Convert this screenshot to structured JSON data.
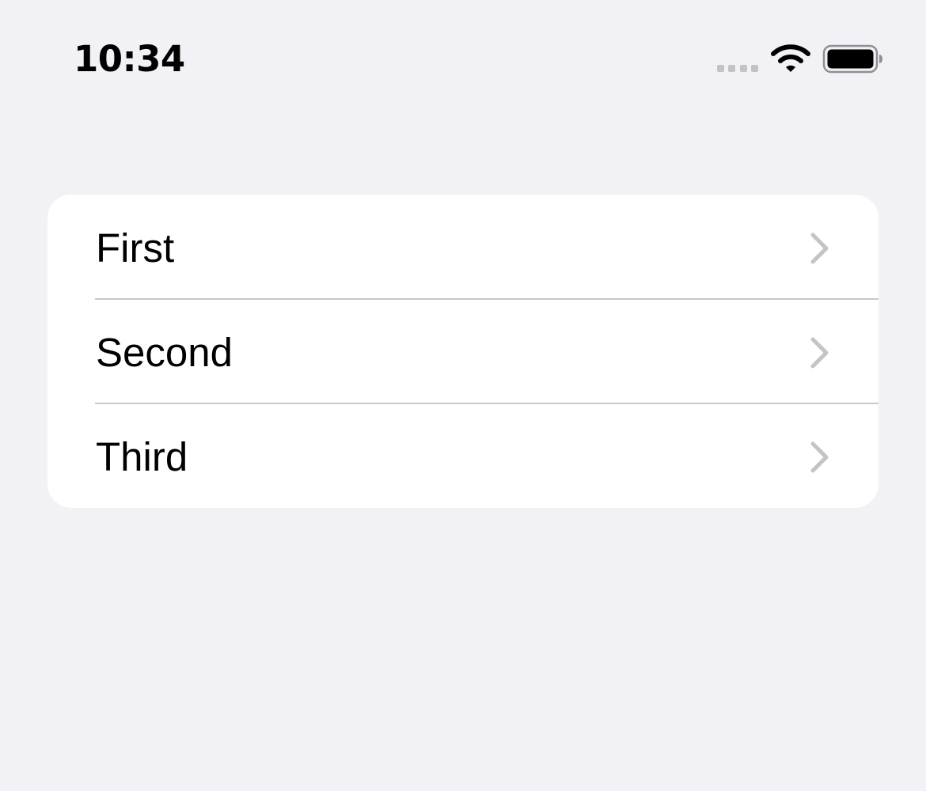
{
  "status_bar": {
    "time": "10:34",
    "signal_icon": "cellular-signal-icon",
    "wifi_icon": "wifi-icon",
    "battery_icon": "battery-icon"
  },
  "list": {
    "items": [
      {
        "label": "First",
        "accessory_icon": "chevron-right-icon"
      },
      {
        "label": "Second",
        "accessory_icon": "chevron-right-icon"
      },
      {
        "label": "Third",
        "accessory_icon": "chevron-right-icon"
      }
    ]
  },
  "colors": {
    "background": "#f2f1f6",
    "card": "#ffffff",
    "chevron": "#c4c4c7",
    "separator": "#c8c7cc",
    "text": "#000000"
  }
}
